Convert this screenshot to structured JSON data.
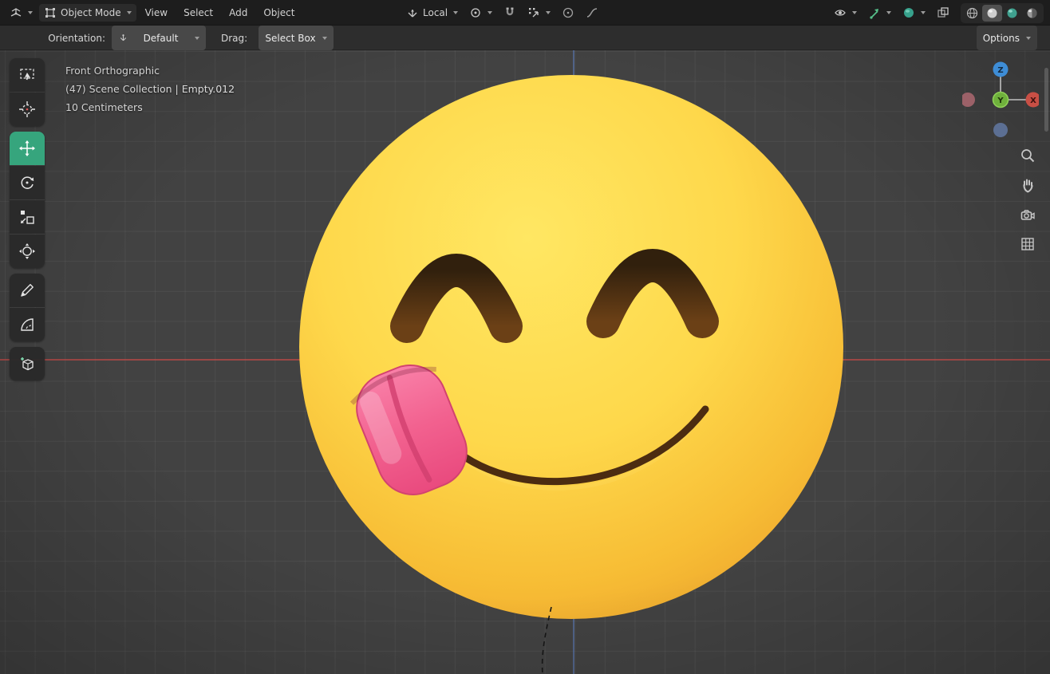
{
  "topbar": {
    "mode": {
      "label": "Object Mode"
    },
    "menus": [
      {
        "label": "View"
      },
      {
        "label": "Select"
      },
      {
        "label": "Add"
      },
      {
        "label": "Object"
      }
    ],
    "transform_orientation": {
      "label": "Local"
    }
  },
  "tool_header": {
    "orientation_label": "Orientation:",
    "orientation_value": "Default",
    "drag_label": "Drag:",
    "drag_value": "Select Box",
    "options_label": "Options"
  },
  "viewport": {
    "view_name": "Front Orthographic",
    "context_path": "(47) Scene Collection | Empty.012",
    "grid_scale": "10 Centimeters"
  },
  "nav_gizmo": {
    "x_label": "X",
    "y_label": "Y",
    "z_label": "Z"
  },
  "toolbar": {
    "active_tool": "move",
    "tools": [
      "select-box",
      "cursor-3d",
      "move",
      "rotate",
      "scale",
      "transform",
      "annotate",
      "measure",
      "add-cube"
    ]
  },
  "colors": {
    "active_tool": "#36a57d",
    "header_bg": "#1d1d1d",
    "viewport_bg": "#424242",
    "axis_x": "#ba4a47",
    "axis_z": "#5a79b8",
    "emoji_yellow": "#fcc63a",
    "emoji_shadow": "#e99e2a",
    "tongue_pink": "#f0608f",
    "gizmo_x": "#c84f45",
    "gizmo_y": "#6fb13c",
    "gizmo_z": "#3e8dd6"
  }
}
